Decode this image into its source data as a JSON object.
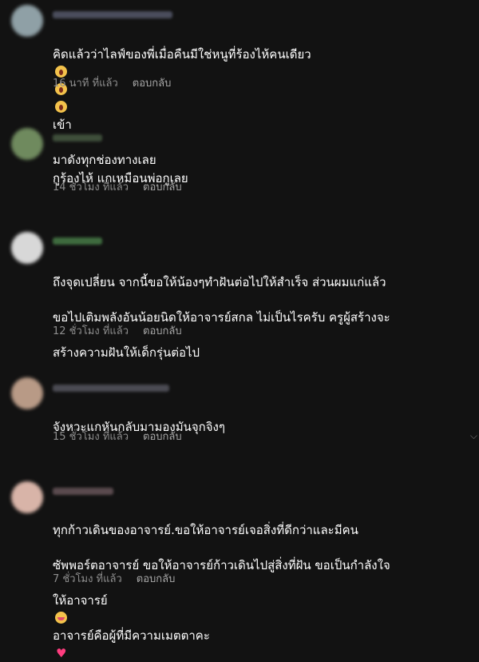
{
  "comments": [
    {
      "text_lines": [
        "คิดแล้วว่าไลฟ์ของพี่เมื่อคืนมีใช่หนูที่ร้องไห้คนเดียว",
        "มาดังทุกช่องทางเลย"
      ],
      "trailing_after_emojis": "เข้า",
      "time": "16 นาที ที่แล้ว",
      "reply": "ตอบกลับ",
      "avatar_color": "#8fa0a6",
      "name_color": "#4a4d5c"
    },
    {
      "text_lines": [
        "กูร้องไห้ แกเหมือนพ่อกูเลย"
      ],
      "time": "14 ชั่วโมง ที่แล้ว",
      "reply": "ตอบกลับ",
      "avatar_color": "#6f8a5e",
      "name_color": "#3e4e3a"
    },
    {
      "text_lines": [
        "ถึงจุดเปลี่ยน จากนี้ขอให้น้องๆทำฝันต่อไปให้สำเร็จ ส่วนผมแก่แล้ว",
        "ขอไปเติมพลังอันน้อยนิดให้อาจารย์สกล ไม่เป็นไรครับ ครูผู้สร้างจะ",
        "สร้างความฝันให้เด็กรุ่นต่อไป"
      ],
      "time": "12 ชั่วโมง ที่แล้ว",
      "reply": "ตอบกลับ",
      "avatar_color": "#d8d8d8",
      "name_color": "#3f6b3f"
    },
    {
      "text_lines": [
        "จังหวะแกหันกลับมามองมันจุกจิงๆ"
      ],
      "time": "15 ชั่วโมง ที่แล้ว",
      "reply": "ตอบกลับ",
      "avatar_color": "#b89a86",
      "name_color": "#4a4a52"
    },
    {
      "text_lines": [
        "ทุกก้าวเดินของอาจารย์.ขอให้อาจารย์เจอสิ่งที่ดีกว่าและมีคน",
        "ซัพพอร์ตอาจารย์ ขอให้อาจารย์ก้าวเดินไปสู่สิ่งที่ฝัน ขอเป็นกำลังใจ"
      ],
      "third_line_start": "ให้อาจารย์",
      "third_line_end": "อาจารย์คือผู้ที่มีความเมตตาคะ",
      "time": "7 ชั่วโมง ที่แล้ว",
      "reply": "ตอบกลับ",
      "avatar_color": "#d8b4a8",
      "name_color": "#5a4a4e"
    }
  ],
  "icons": {
    "crying_emoji": "loudly-crying-face-icon",
    "love_emoji": "smiling-face-with-hearts-icon",
    "heart": "pink-heart-icon"
  },
  "glyphs": {
    "heart": "♥",
    "scroll_hint": "⌵"
  },
  "colors": {
    "background": "#121212",
    "text": "#ffffff",
    "meta": "#8e8e8e"
  }
}
